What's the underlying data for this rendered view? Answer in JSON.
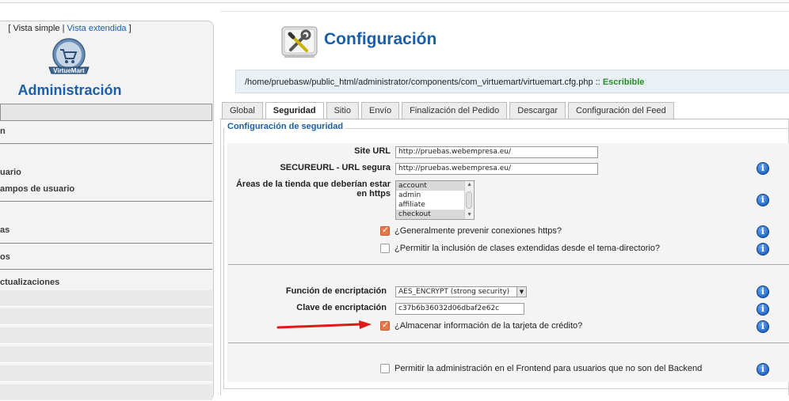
{
  "sidebar": {
    "view_open": "[",
    "view_simple": "Vista simple",
    "view_sep": "|",
    "view_extended": "Vista extendida",
    "view_close": "]",
    "logo_text": "VirtueMart",
    "title": "Administración",
    "menu": [
      {
        "label": "n"
      },
      {
        "label": "uario"
      },
      {
        "label": "ampos de usuario"
      },
      {
        "label": "as"
      },
      {
        "label": "os"
      },
      {
        "label": "ctualizaciones"
      }
    ]
  },
  "header": {
    "title": "Configuración",
    "icon": "wrench-screwdriver-icon",
    "path": "/home/pruebasw/public_html/administrator/components/com_virtuemart/virtuemart.cfg.php",
    "path_sep": "::",
    "status": "Escribible",
    "status_color": "#239023"
  },
  "tabs": [
    {
      "label": "Global",
      "active": false
    },
    {
      "label": "Seguridad",
      "active": true
    },
    {
      "label": "Sitio",
      "active": false
    },
    {
      "label": "Envío",
      "active": false
    },
    {
      "label": "Finalización del Pedido",
      "active": false
    },
    {
      "label": "Descargar",
      "active": false
    },
    {
      "label": "Configuración del Feed",
      "active": false
    }
  ],
  "security": {
    "legend": "Configuración de seguridad",
    "site_url_label": "Site URL",
    "site_url_value": "http://pruebas.webempresa.eu/",
    "secure_url_label": "SECUREURL - URL segura",
    "secure_url_value": "http://pruebas.webempresa.eu/",
    "https_areas_label_1": "Áreas de la tienda que deberían estar",
    "https_areas_label_2": "en https",
    "https_areas_options": [
      "account",
      "admin",
      "affiliate",
      "checkout"
    ],
    "https_areas_selected": [
      "account",
      "checkout"
    ],
    "prevent_https_label": "¿Generalmente prevenir conexiones https?",
    "prevent_https_checked": true,
    "extended_classes_label": "¿Permitir la inclusión de clases extendidas desde el tema-directorio?",
    "extended_classes_checked": false,
    "encrypt_function_label": "Función de encriptación",
    "encrypt_function_value": "AES_ENCRYPT (strong security)",
    "encrypt_key_label": "Clave de encriptación",
    "encrypt_key_value": "c37b6b36032d06dbaf2e62c",
    "store_cc_label": "¿Almacenar información de la tarjeta de crédito?",
    "store_cc_checked": true,
    "frontend_admin_label": "Permitir la administración en el Frontend para usuarios que no son del Backend",
    "frontend_admin_checked": false
  },
  "colors": {
    "accent": "#1a5fa8",
    "checkbox_checked": "#e8794b",
    "info_icon": "#0d4fb8",
    "arrow": "#e01818"
  }
}
